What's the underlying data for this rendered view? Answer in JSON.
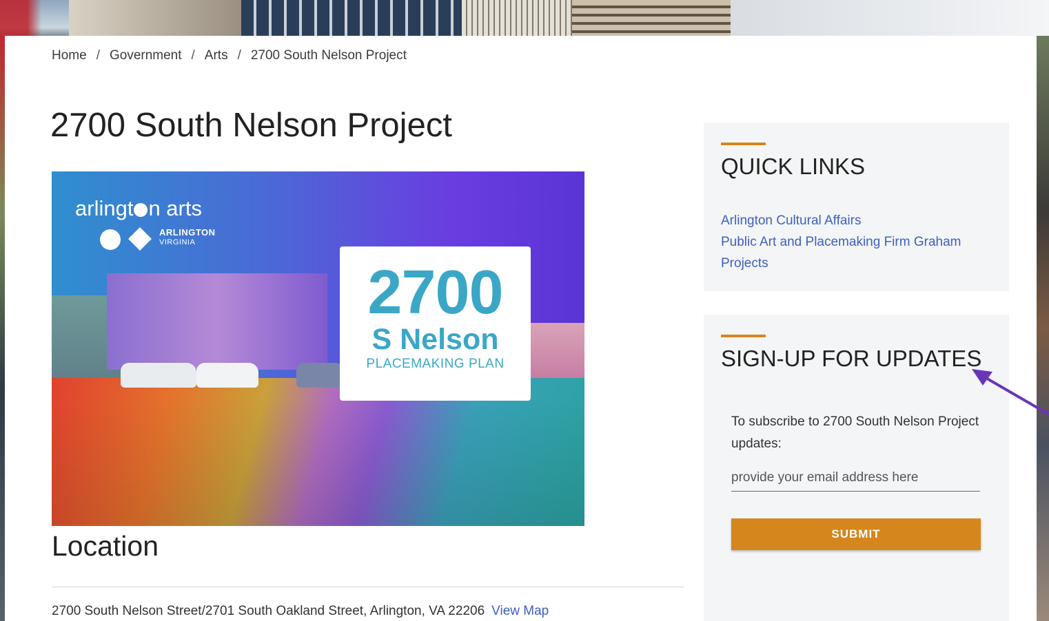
{
  "breadcrumb": {
    "items": [
      "Home",
      "Government",
      "Arts",
      "2700 South Nelson Project"
    ],
    "separator": "/"
  },
  "page": {
    "title": "2700 South Nelson Project"
  },
  "hero": {
    "brand": "arlingt",
    "brand_suffix": "n arts",
    "arlington": "ARLINGTON",
    "virginia": "VIRGINIA",
    "logo_number": "2700",
    "logo_street": "S Nelson",
    "logo_sub": "PLACEMAKING PLAN"
  },
  "location": {
    "title": "Location",
    "address": "2700 South Nelson Street/2701 South Oakland Street, Arlington, VA 22206",
    "map_link": "View Map"
  },
  "quick_links": {
    "title": "QUICK LINKS",
    "links": [
      "Arlington Cultural Affairs",
      "Public Art and Placemaking Firm Graham Projects"
    ]
  },
  "signup": {
    "title": "SIGN-UP FOR UPDATES",
    "text": "To subscribe to 2700 South Nelson Project updates:",
    "email_placeholder": "provide your email address here",
    "submit_label": "SUBMIT"
  },
  "colors": {
    "accent": "#d5861d",
    "link": "#3d5fc1",
    "logo": "#3aa7c7",
    "annotation": "#6a35b8"
  }
}
